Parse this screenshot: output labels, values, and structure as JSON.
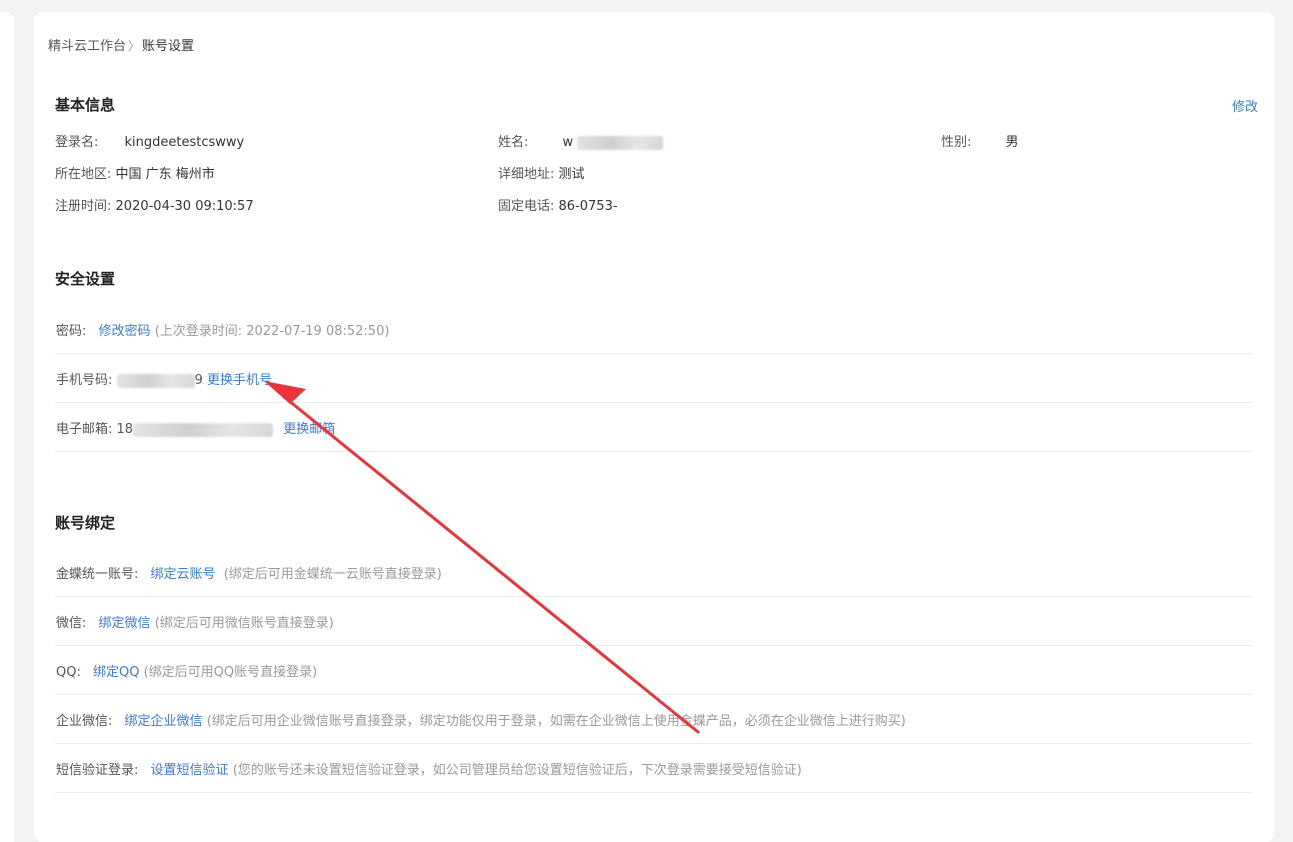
{
  "breadcrumb": {
    "root": "精斗云工作台",
    "separator": "〉",
    "current": "账号设置"
  },
  "basic": {
    "title": "基本信息",
    "edit": "修改",
    "login_label": "登录名:",
    "login_value": "kingdeetestcswwy",
    "name_label": "姓名:",
    "name_value": "w",
    "gender_label": "性别:",
    "gender_value": "男",
    "region_label": "所在地区:",
    "region_value": "中国 广东 梅州市",
    "address_label": "详细地址:",
    "address_value": "测试",
    "regtime_label": "注册时间:",
    "regtime_value": "2020-04-30 09:10:57",
    "phone_label": "固定电话:",
    "phone_value": "86-0753-"
  },
  "security": {
    "title": "安全设置",
    "password_label": "密码:",
    "password_link": "修改密码",
    "password_hint": "(上次登录时间: 2022-07-19 08:52:50)",
    "mobile_label": "手机号码:",
    "mobile_value_suffix": "9",
    "mobile_link": "更换手机号",
    "email_label": "电子邮箱:",
    "email_value_prefix": "18",
    "email_link": "更换邮箱"
  },
  "binding": {
    "title": "账号绑定",
    "items": [
      {
        "label": "金蝶统一账号:",
        "link": "绑定云账号",
        "hint": "(绑定后可用金蝶统一云账号直接登录)"
      },
      {
        "label": "微信:",
        "link": "绑定微信",
        "hint": "(绑定后可用微信账号直接登录)"
      },
      {
        "label": "QQ:",
        "link": "绑定QQ",
        "hint": "(绑定后可用QQ账号直接登录)"
      },
      {
        "label": "企业微信:",
        "link": "绑定企业微信",
        "hint": "(绑定后可用企业微信账号直接登录，绑定功能仅用于登录，如需在企业微信上使用金蝶产品，必须在企业微信上进行购买)"
      },
      {
        "label": "短信验证登录:",
        "link": "设置短信验证",
        "hint": "(您的账号还未设置短信验证登录，如公司管理员给您设置短信验证后，下次登录需要接受短信验证)"
      }
    ]
  },
  "colors": {
    "link": "#3a7bd5",
    "arrow": "#e8343a",
    "background": "#f2f3f5"
  },
  "annotation": {
    "type": "red-arrow",
    "points_to": "更换手机号"
  }
}
